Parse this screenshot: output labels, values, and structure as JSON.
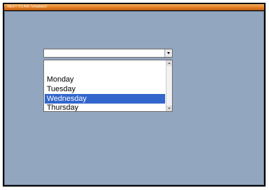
{
  "window": {
    "title": "NEXT TO AIR Template2"
  },
  "combo": {
    "value": ""
  },
  "list": {
    "items": [
      {
        "label": "Monday"
      },
      {
        "label": "Tuesday"
      },
      {
        "label": "Wednesday"
      },
      {
        "label": "Thursday"
      }
    ],
    "selected": "Wednesday"
  },
  "colors": {
    "canvas": "#93a6c0",
    "titlebar": "#e8862a",
    "selection": "#3366cc"
  }
}
